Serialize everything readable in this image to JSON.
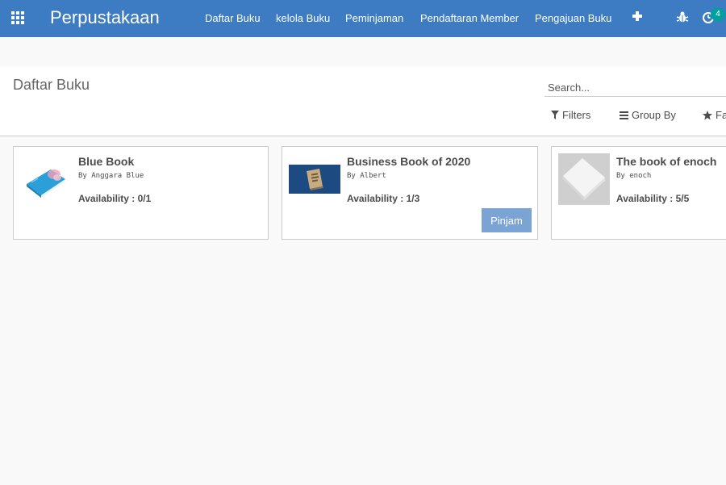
{
  "navbar": {
    "brand": "Perpustakaan",
    "menu": [
      "Daftar Buku",
      "kelola Buku",
      "Peminjaman",
      "Pendaftaran Member",
      "Pengajuan Buku"
    ],
    "activity_count": "4",
    "accent_color": "#3d7cc2"
  },
  "control_panel": {
    "breadcrumb": "Daftar Buku",
    "search_placeholder": "Search...",
    "filters_label": "Filters",
    "group_by_label": "Group By",
    "favorites_label": "Fa"
  },
  "books": [
    {
      "title": "Blue Book",
      "author": "By Anggara Blue",
      "availability": "Availability : 0/1"
    },
    {
      "title": "Business Book of 2020",
      "author": "By Albert",
      "availability": "Availability : 1/3",
      "action_label": "Pinjam"
    },
    {
      "title": "The book of enoch",
      "author": "By enoch",
      "availability": "Availability : 5/5"
    }
  ]
}
